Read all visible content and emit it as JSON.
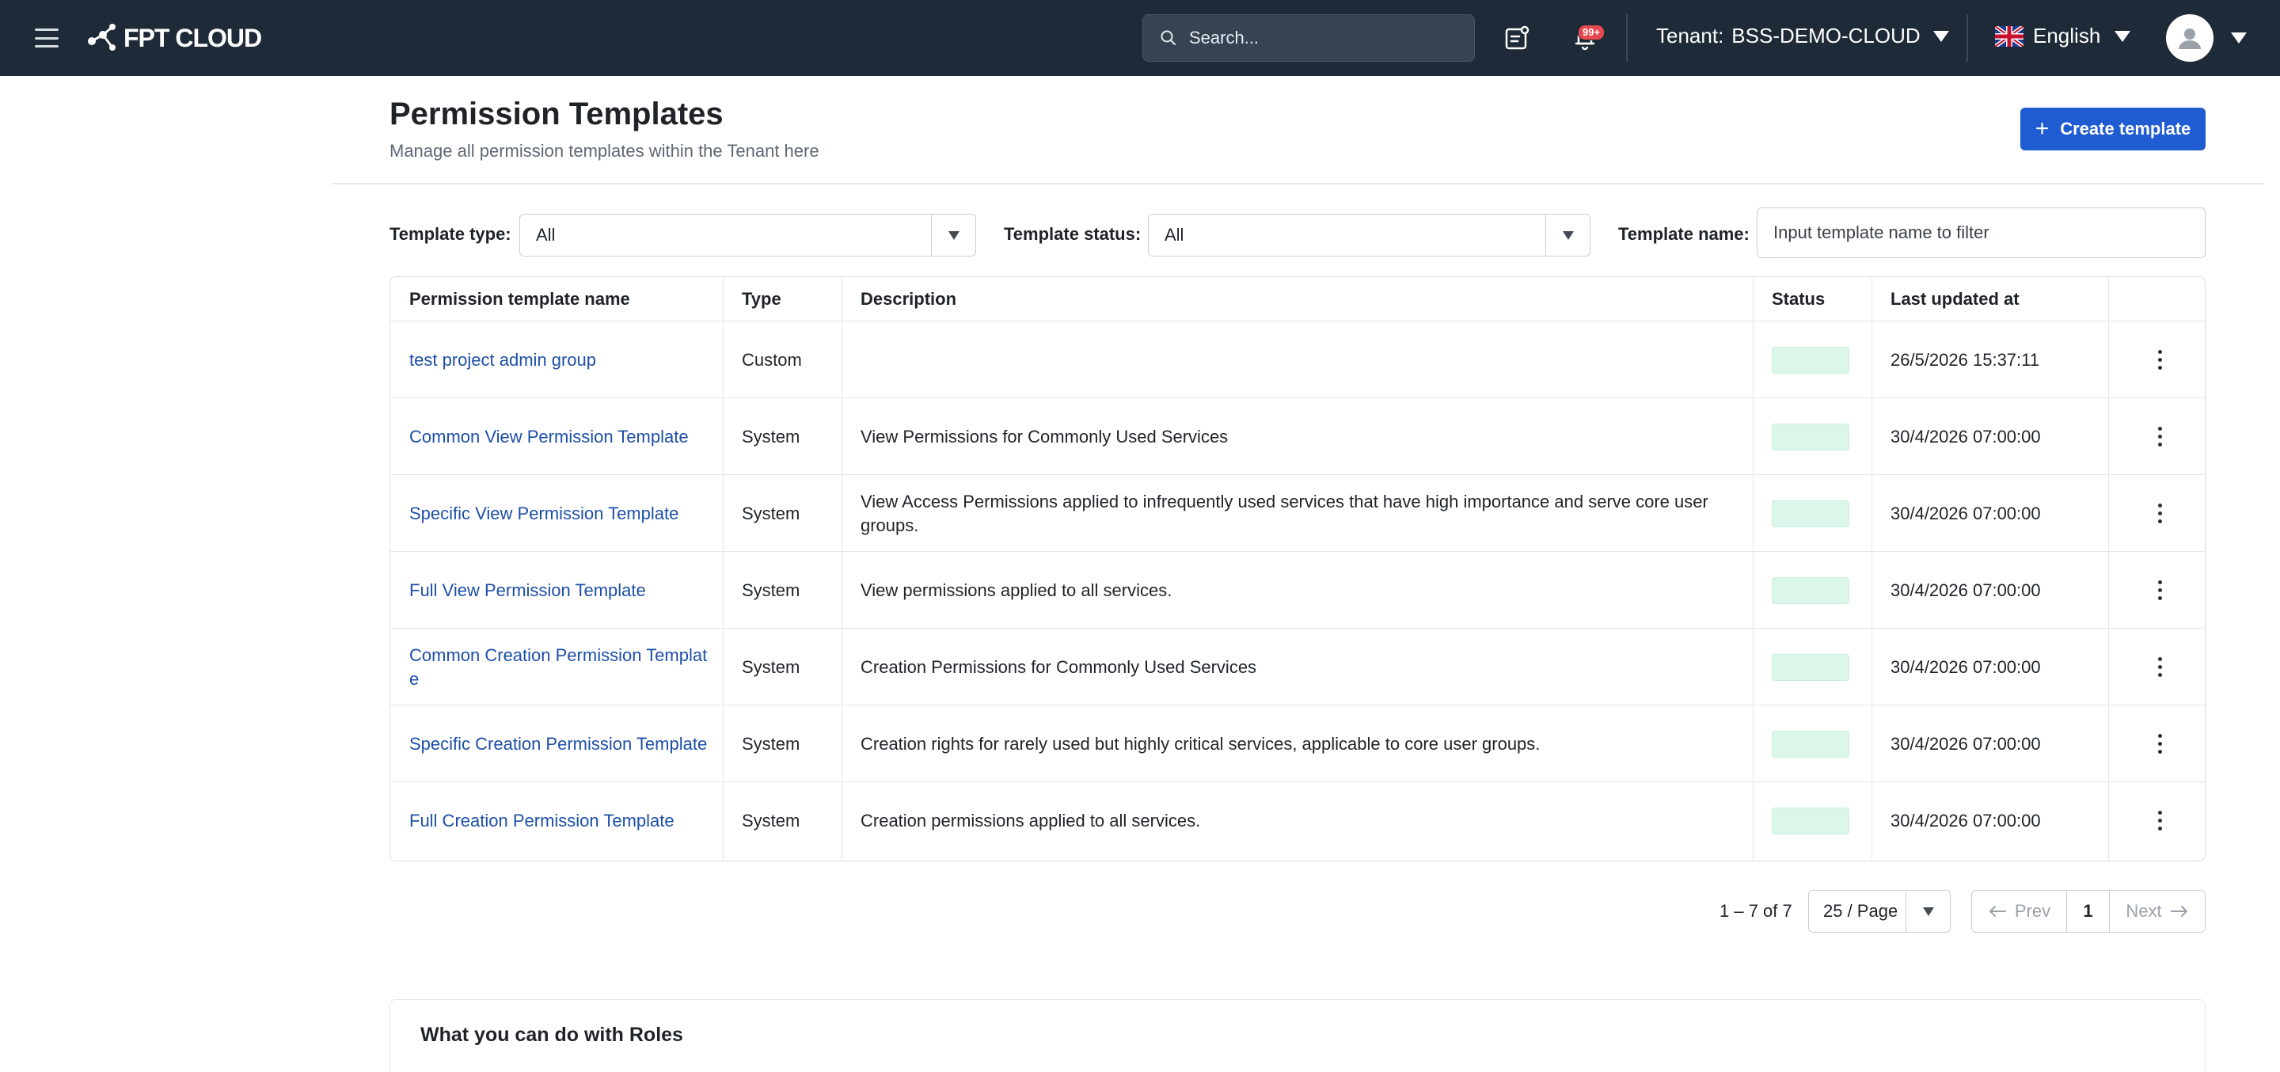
{
  "header": {
    "brand": "FPT CLOUD",
    "search_placeholder": "Search...",
    "notification_badge": "99+",
    "tenant_label": "Tenant:",
    "tenant_value": "BSS-DEMO-CLOUD",
    "language": "English"
  },
  "page": {
    "title": "Permission Templates",
    "subtitle": "Manage all permission templates within the Tenant here",
    "create_button": "Create template"
  },
  "filters": {
    "type_label": "Template type:",
    "type_value": "All",
    "status_label": "Template status:",
    "status_value": "All",
    "name_label": "Template name:",
    "name_placeholder": "Input template name to filter"
  },
  "table": {
    "columns": [
      "Permission template name",
      "Type",
      "Description",
      "Status",
      "Last updated at"
    ],
    "rows": [
      {
        "name": "test project admin group",
        "type": "Custom",
        "description": "",
        "updated": "26/5/2026 15:37:11"
      },
      {
        "name": "Common View Permission Template",
        "type": "System",
        "description": "View Permissions for Commonly Used Services",
        "updated": "30/4/2026 07:00:00"
      },
      {
        "name": "Specific View Permission Template",
        "type": "System",
        "description": "View Access Permissions applied to infrequently used services that have high importance and serve core user groups.",
        "updated": "30/4/2026 07:00:00"
      },
      {
        "name": "Full View Permission Template",
        "type": "System",
        "description": "View permissions applied to all services.",
        "updated": "30/4/2026 07:00:00"
      },
      {
        "name": "Common Creation Permission Template",
        "type": "System",
        "description": "Creation Permissions for Commonly Used Services",
        "updated": "30/4/2026 07:00:00"
      },
      {
        "name": "Specific Creation Permission Template",
        "type": "System",
        "description": "Creation rights for rarely used but highly critical services, applicable to core user groups.",
        "updated": "30/4/2026 07:00:00"
      },
      {
        "name": "Full Creation Permission Template",
        "type": "System",
        "description": "Creation permissions applied to all services.",
        "updated": "30/4/2026 07:00:00"
      }
    ]
  },
  "pagination": {
    "range": "1 – 7 of 7",
    "page_size": "25 / Page",
    "prev": "Prev",
    "current": "1",
    "next": "Next"
  },
  "info": {
    "title": "What you can do with Roles"
  },
  "colors": {
    "topbar": "#1e2a38",
    "primary": "#1f5bd1",
    "link": "#1d4fa8",
    "status_active": "#dcf7ea"
  }
}
